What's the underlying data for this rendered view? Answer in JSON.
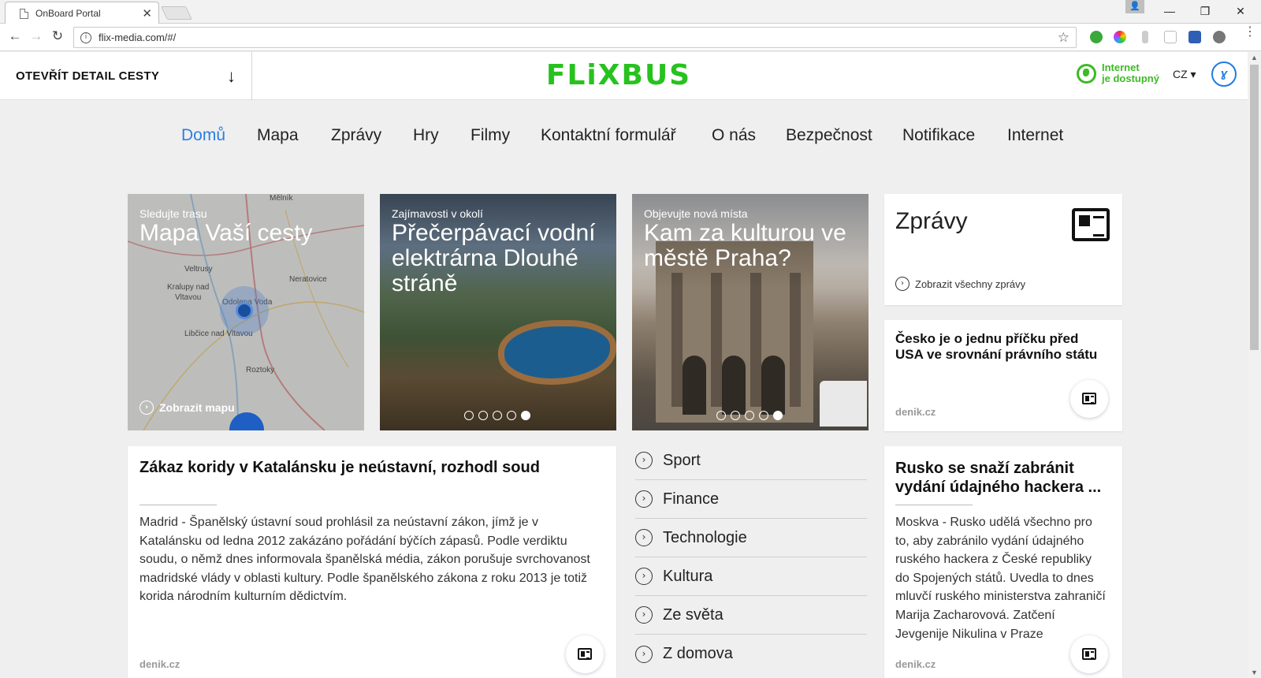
{
  "browser": {
    "tab_title": "OnBoard Portal",
    "url": "flix-media.com/#/"
  },
  "header": {
    "trip_detail_label": "OTEVŘÍT DETAIL CESTY",
    "logo_text": "FLiXBUS",
    "wifi_line1": "Internet",
    "wifi_line2": "je dostupný",
    "language": "CZ ▾",
    "brand_color": "#27c21f",
    "accent_color": "#2b7fe0"
  },
  "nav": {
    "items": [
      {
        "label": "Domů",
        "active": true
      },
      {
        "label": "Mapa"
      },
      {
        "label": "Zprávy"
      },
      {
        "label": "Hry"
      },
      {
        "label": "Filmy"
      },
      {
        "label": "Kontaktní formulář"
      },
      {
        "label": "O nás"
      },
      {
        "label": "Bezpečnost"
      },
      {
        "label": "Notifikace"
      },
      {
        "label": "Internet"
      }
    ]
  },
  "map_tile": {
    "kicker": "Sledujte trasu",
    "title": "Mapa Vaší cesty",
    "link": "Zobrazit mapu",
    "places": [
      "Mělník",
      "Veltrusy",
      "Kralupy nad",
      "Vltavou",
      "Neratovice",
      "Odolena Voda",
      "Libčice nad Vltavou",
      "Roztoky"
    ]
  },
  "tile_dam": {
    "kicker": "Zajímavosti v okolí",
    "title": "Přečerpávací vodní elektrárna Dlouhé stráně"
  },
  "tile_theatre": {
    "kicker": "Objevujte nová místa",
    "title": "Kam za kulturou ve městě Praha?"
  },
  "news_header": {
    "title": "Zprávy",
    "link": "Zobrazit všechny zprávy"
  },
  "news_small": {
    "headline": "Česko je o jednu příčku před USA ve srovnání právního státu",
    "source": "denik.cz"
  },
  "article_main": {
    "headline": "Zákaz koridy v Katalánsku je neústavní, rozhodl soud",
    "text": "Madrid - Španělský ústavní soud prohlásil za neústavní zákon, jímž je v Katalánsku od ledna 2012 zakázáno pořádání býčích zápasů. Podle verdiktu soudu, o němž dnes informovala španělská média, zákon porušuje svrchovanost madridské vlády v oblasti kultury. Podle španělského zákona z roku 2013 je totiž korida národním kulturním dědictvím.",
    "source": "denik.cz"
  },
  "categories": [
    "Sport",
    "Finance",
    "Technologie",
    "Kultura",
    "Ze světa",
    "Z domova"
  ],
  "article_side": {
    "headline": "Rusko se snaží zabránit vydání údajného hackera ...",
    "text": "Moskva - Rusko udělá všechno pro to, aby zabránilo vydání údajného ruského hackera z České republiky do Spojených států. Uvedla to dnes mluvčí ruského ministerstva zahraničí Marija Zacharovová. Zatčení Jevgenije Nikulina v Praze",
    "source": "denik.cz"
  }
}
